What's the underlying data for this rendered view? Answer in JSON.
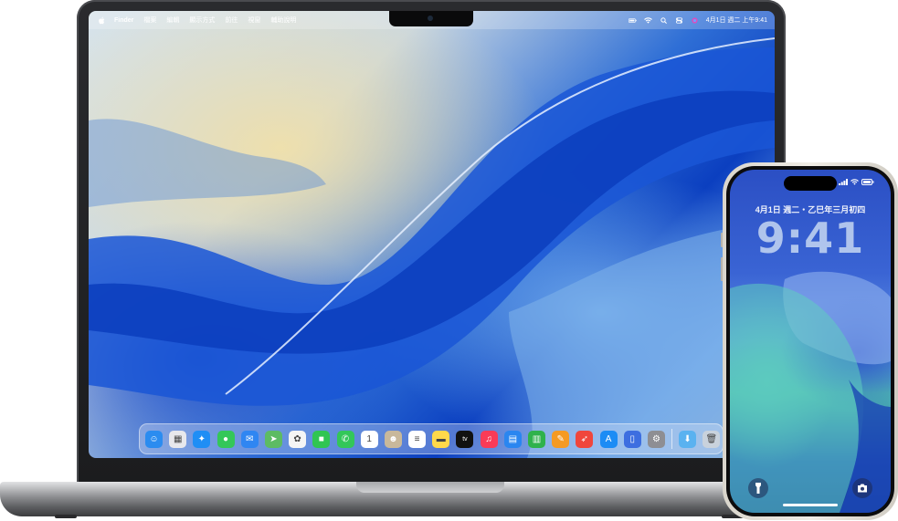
{
  "mac": {
    "menubar": {
      "app_name": "Finder",
      "items": [
        "檔案",
        "編輯",
        "顯示方式",
        "前往",
        "視窗",
        "輔助說明"
      ],
      "datetime": "4月1日 週二  上午9:41"
    },
    "dock": {
      "apps": [
        {
          "name": "finder-icon",
          "color": "#2b8cf0",
          "glyph": "☺"
        },
        {
          "name": "launchpad-icon",
          "color": "#e8e8ec",
          "glyph": "▦"
        },
        {
          "name": "safari-icon",
          "color": "#1f8ef5",
          "glyph": "✦"
        },
        {
          "name": "messages-icon",
          "color": "#34c759",
          "glyph": "●"
        },
        {
          "name": "mail-icon",
          "color": "#2f86f2",
          "glyph": "✉"
        },
        {
          "name": "maps-icon",
          "color": "#5dbb63",
          "glyph": "➤"
        },
        {
          "name": "photos-icon",
          "color": "#f5f5f5",
          "glyph": "✿"
        },
        {
          "name": "facetime-icon",
          "color": "#30c552",
          "glyph": "■"
        },
        {
          "name": "phone-icon",
          "color": "#33c759",
          "glyph": "✆"
        },
        {
          "name": "calendar-icon",
          "color": "#ffffff",
          "glyph": "1"
        },
        {
          "name": "contacts-icon",
          "color": "#c8b89b",
          "glyph": "☻"
        },
        {
          "name": "reminders-icon",
          "color": "#ffffff",
          "glyph": "≡"
        },
        {
          "name": "notes-icon",
          "color": "#ffd94a",
          "glyph": "▬"
        },
        {
          "name": "apple-tv-icon",
          "color": "#111111",
          "glyph": "tv"
        },
        {
          "name": "music-icon",
          "color": "#fa3b57",
          "glyph": "♫"
        },
        {
          "name": "keynote-icon",
          "color": "#2a86f0",
          "glyph": "▤"
        },
        {
          "name": "numbers-icon",
          "color": "#2fb24c",
          "glyph": "▥"
        },
        {
          "name": "pages-icon",
          "color": "#f59a23",
          "glyph": "✎"
        },
        {
          "name": "app-launcher-icon",
          "color": "#f0463c",
          "glyph": "➶"
        },
        {
          "name": "app-store-icon",
          "color": "#1c8cf5",
          "glyph": "A"
        },
        {
          "name": "iphone-mirroring-icon",
          "color": "#3d6ee0",
          "glyph": "▯"
        },
        {
          "name": "system-settings-icon",
          "color": "#8e8e93",
          "glyph": "⚙"
        }
      ],
      "trailing": [
        {
          "name": "downloads-folder-icon",
          "color": "#5ab2f0",
          "glyph": "⬇"
        },
        {
          "name": "trash-icon",
          "color": "#c9d2dc",
          "glyph": "🗑"
        }
      ]
    }
  },
  "iphone": {
    "date": "4月1日 週二・乙巳年三月初四",
    "time": "9:41"
  }
}
